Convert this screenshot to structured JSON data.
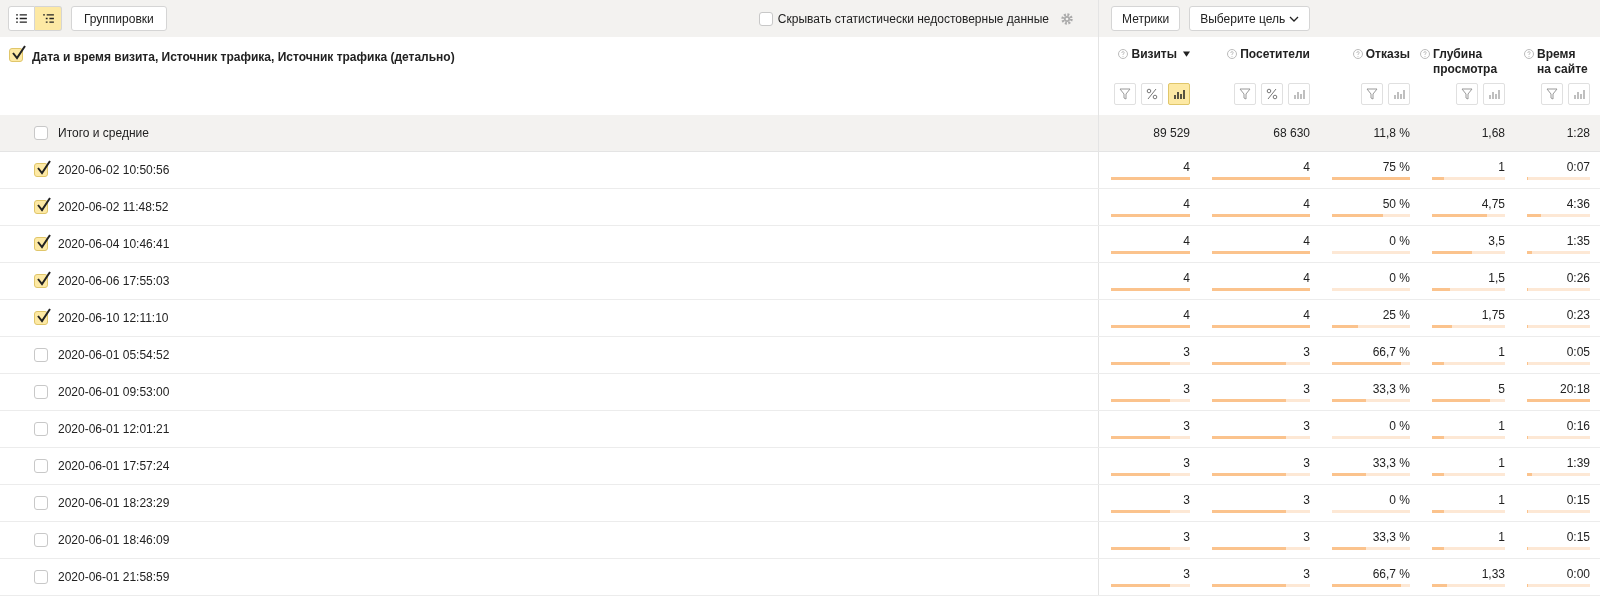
{
  "toolbar": {
    "view_toggles": [
      {
        "selected": false
      },
      {
        "selected": true
      }
    ],
    "groupings_button": "Группировки",
    "hide_unreliable": {
      "label": "Скрывать статистически недостоверные данные",
      "checked": false
    },
    "metrics_button": "Метрики",
    "goal_select": "Выберите цель"
  },
  "dimensions": {
    "label": "Дата и время визита, Источник трафика, Источник трафика (детально)",
    "checked": true
  },
  "columns": [
    {
      "title": "Визиты",
      "sorted": true,
      "tools": [
        {
          "kind": "filter",
          "selected": false
        },
        {
          "kind": "percent",
          "selected": false
        },
        {
          "kind": "bars",
          "selected": true
        }
      ]
    },
    {
      "title": "Посетители",
      "sorted": false,
      "tools": [
        {
          "kind": "filter",
          "selected": false
        },
        {
          "kind": "percent",
          "selected": false
        },
        {
          "kind": "bars",
          "selected": false
        }
      ]
    },
    {
      "title": "Отказы",
      "sorted": false,
      "tools": [
        {
          "kind": "filter",
          "selected": false
        },
        {
          "kind": "bars",
          "selected": false
        }
      ]
    },
    {
      "title": "Глубина просмотра",
      "sorted": false,
      "tools": [
        {
          "kind": "filter",
          "selected": false
        },
        {
          "kind": "bars",
          "selected": false
        }
      ]
    },
    {
      "title": "Время на сайте",
      "sorted": false,
      "tools": [
        {
          "kind": "filter",
          "selected": false
        },
        {
          "kind": "bars",
          "selected": false
        }
      ]
    }
  ],
  "totals": {
    "label": "Итого и средние",
    "checked": false,
    "values": [
      "89 529",
      "68 630",
      "11,8 %",
      "1,68",
      "1:28"
    ]
  },
  "rows": [
    {
      "label": "2020-06-02 10:50:56",
      "checked": true,
      "cells": [
        {
          "value": "4",
          "level": 1
        },
        {
          "value": "4",
          "level": 1
        },
        {
          "value": "75 %",
          "level": 1
        },
        {
          "value": "1",
          "level": 0.16
        },
        {
          "value": "0:07",
          "level": 0.01
        }
      ]
    },
    {
      "label": "2020-06-02 11:48:52",
      "checked": true,
      "cells": [
        {
          "value": "4",
          "level": 1
        },
        {
          "value": "4",
          "level": 1
        },
        {
          "value": "50 %",
          "level": 0.66
        },
        {
          "value": "4,75",
          "level": 0.76
        },
        {
          "value": "4:36",
          "level": 0.22
        }
      ]
    },
    {
      "label": "2020-06-04 10:46:41",
      "checked": true,
      "cells": [
        {
          "value": "4",
          "level": 1
        },
        {
          "value": "4",
          "level": 1
        },
        {
          "value": "0 %",
          "level": 0
        },
        {
          "value": "3,5",
          "level": 0.55
        },
        {
          "value": "1:35",
          "level": 0.08
        }
      ]
    },
    {
      "label": "2020-06-06 17:55:03",
      "checked": true,
      "cells": [
        {
          "value": "4",
          "level": 1
        },
        {
          "value": "4",
          "level": 1
        },
        {
          "value": "0 %",
          "level": 0
        },
        {
          "value": "1,5",
          "level": 0.25
        },
        {
          "value": "0:26",
          "level": 0.02
        }
      ]
    },
    {
      "label": "2020-06-10 12:11:10",
      "checked": true,
      "cells": [
        {
          "value": "4",
          "level": 1
        },
        {
          "value": "4",
          "level": 1
        },
        {
          "value": "25 %",
          "level": 0.33
        },
        {
          "value": "1,75",
          "level": 0.28
        },
        {
          "value": "0:23",
          "level": 0.02
        }
      ]
    },
    {
      "label": "2020-06-01 05:54:52",
      "checked": false,
      "cells": [
        {
          "value": "3",
          "level": 0.75
        },
        {
          "value": "3",
          "level": 0.75
        },
        {
          "value": "66,7 %",
          "level": 0.89
        },
        {
          "value": "1",
          "level": 0.16
        },
        {
          "value": "0:05",
          "level": 0.01
        }
      ]
    },
    {
      "label": "2020-06-01 09:53:00",
      "checked": false,
      "cells": [
        {
          "value": "3",
          "level": 0.75
        },
        {
          "value": "3",
          "level": 0.75
        },
        {
          "value": "33,3 %",
          "level": 0.44
        },
        {
          "value": "5",
          "level": 0.79
        },
        {
          "value": "20:18",
          "level": 1
        }
      ]
    },
    {
      "label": "2020-06-01 12:01:21",
      "checked": false,
      "cells": [
        {
          "value": "3",
          "level": 0.75
        },
        {
          "value": "3",
          "level": 0.75
        },
        {
          "value": "0 %",
          "level": 0
        },
        {
          "value": "1",
          "level": 0.16
        },
        {
          "value": "0:16",
          "level": 0.01
        }
      ]
    },
    {
      "label": "2020-06-01 17:57:24",
      "checked": false,
      "cells": [
        {
          "value": "3",
          "level": 0.75
        },
        {
          "value": "3",
          "level": 0.75
        },
        {
          "value": "33,3 %",
          "level": 0.44
        },
        {
          "value": "1",
          "level": 0.16
        },
        {
          "value": "1:39",
          "level": 0.08
        }
      ]
    },
    {
      "label": "2020-06-01 18:23:29",
      "checked": false,
      "cells": [
        {
          "value": "3",
          "level": 0.75
        },
        {
          "value": "3",
          "level": 0.75
        },
        {
          "value": "0 %",
          "level": 0
        },
        {
          "value": "1",
          "level": 0.16
        },
        {
          "value": "0:15",
          "level": 0.01
        }
      ]
    },
    {
      "label": "2020-06-01 18:46:09",
      "checked": false,
      "cells": [
        {
          "value": "3",
          "level": 0.75
        },
        {
          "value": "3",
          "level": 0.75
        },
        {
          "value": "33,3 %",
          "level": 0.44
        },
        {
          "value": "1",
          "level": 0.16
        },
        {
          "value": "0:15",
          "level": 0.01
        }
      ]
    },
    {
      "label": "2020-06-01 21:58:59",
      "checked": false,
      "cells": [
        {
          "value": "3",
          "level": 0.75
        },
        {
          "value": "3",
          "level": 0.75
        },
        {
          "value": "66,7 %",
          "level": 0.89
        },
        {
          "value": "1,33",
          "level": 0.2
        },
        {
          "value": "0:00",
          "level": 0.01
        }
      ]
    }
  ]
}
